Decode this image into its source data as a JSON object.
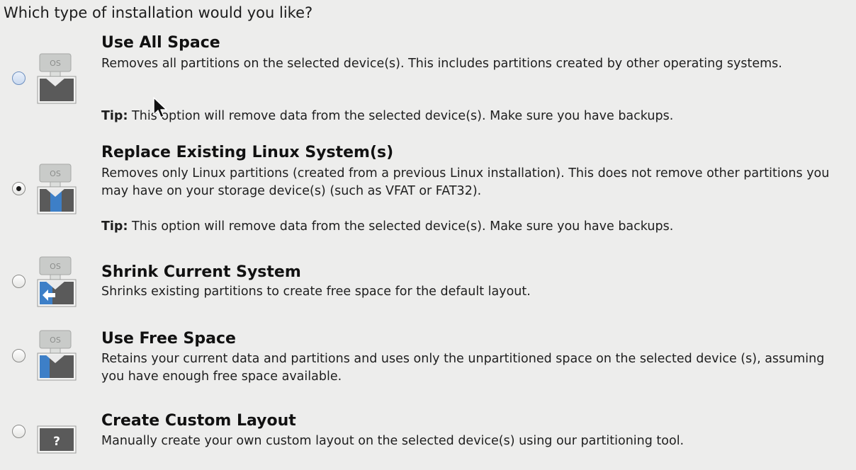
{
  "question": "Which type of installation would you like?",
  "options": [
    {
      "id": "use-all-space",
      "title": "Use All Space",
      "description": "Removes all partitions on the selected device(s).  This includes partitions created by other operating systems.",
      "tip_label": "Tip:",
      "tip_text": " This option will remove data from the selected device(s).  Make sure you have backups.",
      "selected": false,
      "icon": "os-all-space-icon"
    },
    {
      "id": "replace-existing-linux",
      "title": "Replace Existing Linux System(s)",
      "description": "Removes only Linux partitions (created from a previous Linux installation).  This does not remove other partitions you may have on your storage device(s) (such as VFAT or FAT32).",
      "tip_label": "Tip:",
      "tip_text": " This option will remove data from the selected device(s).  Make sure you have backups.",
      "selected": true,
      "icon": "os-replace-linux-icon"
    },
    {
      "id": "shrink-current-system",
      "title": "Shrink Current System",
      "description": "Shrinks existing partitions to create free space for the default layout.",
      "selected": false,
      "icon": "os-shrink-icon"
    },
    {
      "id": "use-free-space",
      "title": "Use Free Space",
      "description": "Retains your current data and partitions and uses only the unpartitioned space on the selected device (s), assuming you have enough free space available.",
      "selected": false,
      "icon": "os-free-space-icon"
    },
    {
      "id": "create-custom-layout",
      "title": "Create Custom Layout",
      "description": "Manually create your own custom layout on the selected device(s) using our partitioning tool.",
      "selected": false,
      "icon": "custom-layout-icon"
    }
  ],
  "icon_text": {
    "os": "OS",
    "custom": "?"
  },
  "colors": {
    "background": "#ededec",
    "disk_dark": "#5a5a5a",
    "partition_blue": "#3d7fc7",
    "tag_gray": "#c9cbc9"
  }
}
